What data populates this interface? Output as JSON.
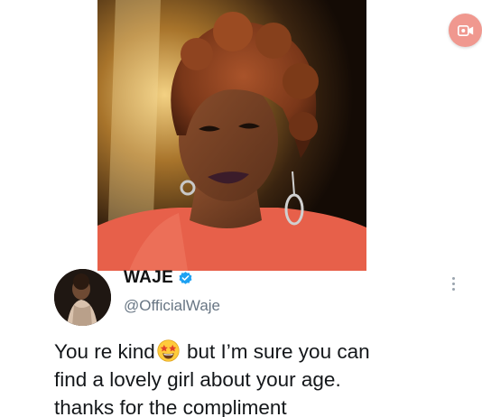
{
  "media": {
    "icon": "portrait-photo"
  },
  "record_button": {
    "icon": "video-record-icon",
    "color": "#f0988f"
  },
  "tweet": {
    "display_name": "WAJE",
    "handle": "@OfficialWaje",
    "verified_icon": "verified-badge-icon",
    "verified_color": "#1da1f2",
    "menu_icon": "more-vertical-icon",
    "text_line_1_before": "You re kind",
    "text_line_1_emoji": "star-struck-emoji",
    "text_line_1_after": " but I’m sure you can",
    "text_line_2": "find a lovely girl about your age.",
    "text_line_3": "thanks for the compliment"
  }
}
